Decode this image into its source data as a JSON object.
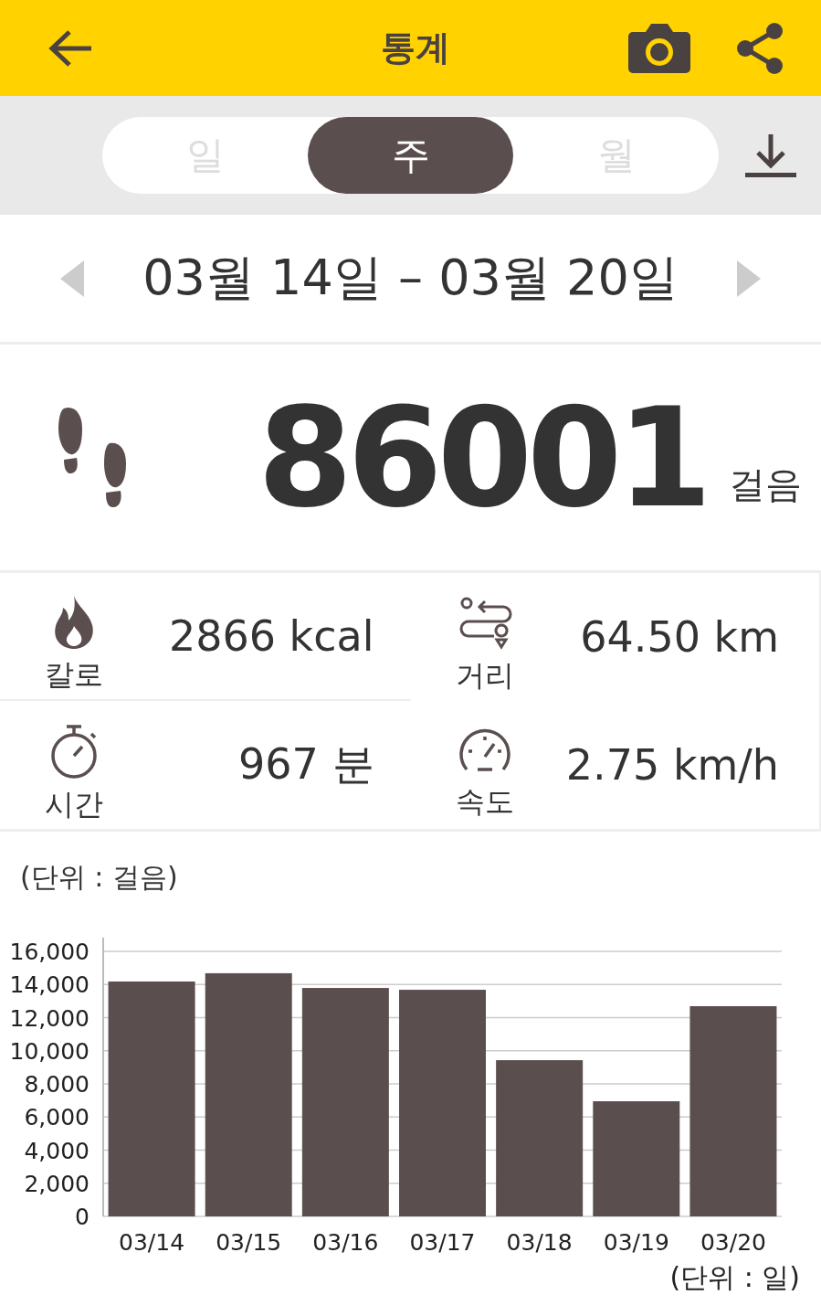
{
  "header": {
    "title": "통계"
  },
  "period_tabs": [
    {
      "label": "일",
      "selected": false
    },
    {
      "label": "주",
      "selected": true
    },
    {
      "label": "월",
      "selected": false
    }
  ],
  "date_range": "03월 14일 – 03월 20일",
  "total": {
    "value": "86001",
    "unit": "걸음"
  },
  "stats": [
    {
      "kind": "calories",
      "label": "칼로",
      "value": "2866 kcal"
    },
    {
      "kind": "distance",
      "label": "거리",
      "value": "64.50 km"
    },
    {
      "kind": "time",
      "label": "시간",
      "value": "967 분"
    },
    {
      "kind": "speed",
      "label": "속도",
      "value": "2.75 km/h"
    }
  ],
  "chart": {
    "unit_label": "(단위 : 걸음)",
    "x_unit_label": "(단위 : 일)",
    "chart_data": {
      "type": "bar",
      "categories": [
        "03/14",
        "03/15",
        "03/16",
        "03/17",
        "03/18",
        "03/19",
        "03/20"
      ],
      "grid": true,
      "series": [
        {
          "color": "#5b4e4e",
          "values": [
            14180,
            14680,
            13790,
            13680,
            9430,
            6950,
            12690
          ]
        }
      ],
      "ylim": [
        0,
        16000
      ],
      "yticks": [
        {
          "value": 0,
          "label": "0"
        },
        {
          "value": 2000,
          "label": "2,000"
        },
        {
          "value": 4000,
          "label": "4,000"
        },
        {
          "value": 6000,
          "label": "6,000"
        },
        {
          "value": 8000,
          "label": "8,000"
        },
        {
          "value": 10000,
          "label": "10,000"
        },
        {
          "value": 12000,
          "label": "12,000"
        },
        {
          "value": 14000,
          "label": "14,000"
        },
        {
          "value": 16000,
          "label": "16,000"
        }
      ]
    }
  }
}
